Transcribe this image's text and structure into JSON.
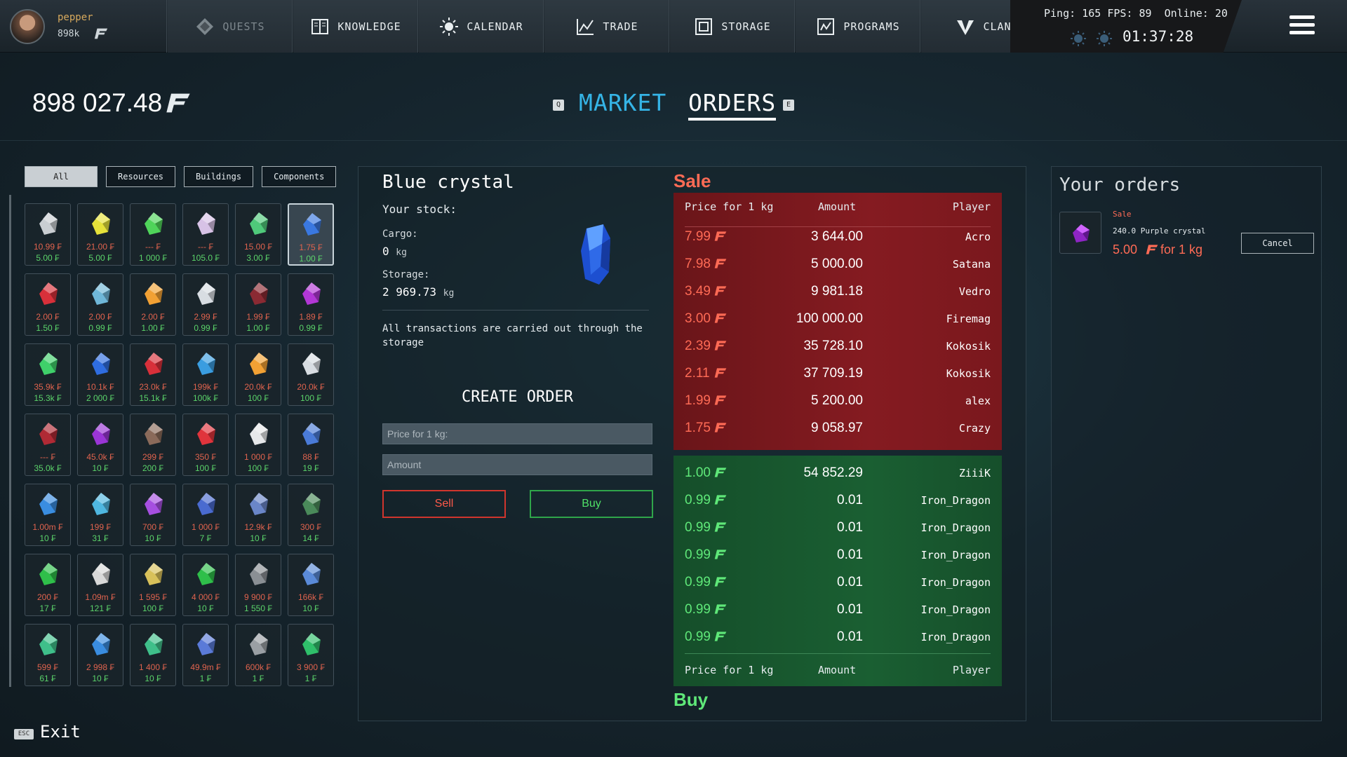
{
  "player": {
    "name": "pepper",
    "cash": "898k"
  },
  "nav": [
    {
      "label": "QUESTS",
      "icon": "diamond-icon",
      "dim": true
    },
    {
      "label": "KNOWLEDGE",
      "icon": "book-icon",
      "dim": false
    },
    {
      "label": "CALENDAR",
      "icon": "sun-icon",
      "dim": false
    },
    {
      "label": "TRADE",
      "icon": "trend-icon",
      "dim": false
    },
    {
      "label": "STORAGE",
      "icon": "box-icon",
      "dim": false
    },
    {
      "label": "PROGRAMS",
      "icon": "program-icon",
      "dim": false
    },
    {
      "label": "CLAN",
      "icon": "clan-icon",
      "dim": false
    }
  ],
  "status": {
    "ping_label": "Ping:",
    "ping": "165",
    "fps_label": "FPS:",
    "fps": "89",
    "online_label": "Online:",
    "online": "20",
    "time": "01:37:28"
  },
  "balance": "898 027.48",
  "tabs": {
    "market": "MARKET",
    "orders": "ORDERS",
    "key_left": "Q",
    "key_right": "E"
  },
  "filters": [
    "All",
    "Resources",
    "Buildings",
    "Components"
  ],
  "inventory": [
    {
      "icon": "ingot-silver-icon",
      "color": "#c9ced2",
      "p1": "10.99",
      "p2": "5.00"
    },
    {
      "icon": "ingot-gold-icon",
      "color": "#e6e23a",
      "p1": "21.00",
      "p2": "5.00"
    },
    {
      "icon": "seeds-icon",
      "color": "#4fd45a",
      "p1": "---",
      "p2": "1 000"
    },
    {
      "icon": "ingot-pink-icon",
      "color": "#d7c2e6",
      "p1": "---",
      "p2": "105.0"
    },
    {
      "icon": "green-crystal-icon",
      "color": "#4fc97a",
      "p1": "15.00",
      "p2": "3.00"
    },
    {
      "icon": "blue-crystal-icon",
      "color": "#3a78e0",
      "p1": "1.75",
      "p2": "1.00",
      "selected": true
    },
    {
      "icon": "red-crystal-icon",
      "color": "#d8303a",
      "p1": "2.00",
      "p2": "1.50"
    },
    {
      "icon": "ice-crystal-icon",
      "color": "#6fb7d8",
      "p1": "2.00",
      "p2": "0.99"
    },
    {
      "icon": "amber-crystal-icon",
      "color": "#f2a134",
      "p1": "2.00",
      "p2": "1.00"
    },
    {
      "icon": "metal-chunk-icon",
      "color": "#d8dde2",
      "p1": "2.99",
      "p2": "0.99"
    },
    {
      "icon": "dark-crystal-icon",
      "color": "#8a2a33",
      "p1": "1.99",
      "p2": "1.00"
    },
    {
      "icon": "purple-crystal-icon",
      "color": "#b237d6",
      "p1": "1.89",
      "p2": "0.99"
    },
    {
      "icon": "green-core-icon",
      "color": "#3fd06a",
      "p1": "35.9k",
      "p2": "15.3k"
    },
    {
      "icon": "blue-core-icon",
      "color": "#2f6de0",
      "p1": "10.1k",
      "p2": "2 000"
    },
    {
      "icon": "red-core-icon",
      "color": "#d8303a",
      "p1": "23.0k",
      "p2": "15.1k"
    },
    {
      "icon": "cyan-core-icon",
      "color": "#3a9de0",
      "p1": "199k",
      "p2": "100k"
    },
    {
      "icon": "gold-core-icon",
      "color": "#f2a134",
      "p1": "20.0k",
      "p2": "100"
    },
    {
      "icon": "silver-core-icon",
      "color": "#d8dde2",
      "p1": "20.0k",
      "p2": "100"
    },
    {
      "icon": "crimson-core-icon",
      "color": "#b02a35",
      "p1": "---",
      "p2": "35.0k"
    },
    {
      "icon": "violet-orb-icon",
      "color": "#9a35d6",
      "p1": "45.0k",
      "p2": "10"
    },
    {
      "icon": "dark-orb-icon",
      "color": "#8a6a5a",
      "p1": "299",
      "p2": "200"
    },
    {
      "icon": "red-pod-icon",
      "color": "#e0343c",
      "p1": "350",
      "p2": "100"
    },
    {
      "icon": "plate-icon",
      "color": "#e6e8ea",
      "p1": "1 000",
      "p2": "100"
    },
    {
      "icon": "battery-icon",
      "color": "#4a7bd8",
      "p1": "88",
      "p2": "19"
    },
    {
      "icon": "blue-gear-icon",
      "color": "#3a8de0",
      "p1": "1.00m",
      "p2": "10"
    },
    {
      "icon": "cyan-gear-icon",
      "color": "#4fb7e0",
      "p1": "199",
      "p2": "31"
    },
    {
      "icon": "purple-lamp-icon",
      "color": "#a64fe0",
      "p1": "700",
      "p2": "10"
    },
    {
      "icon": "blue-grid-icon",
      "color": "#4a6bd0",
      "p1": "1 000",
      "p2": "7"
    },
    {
      "icon": "solar-panel-icon",
      "color": "#6a86c8",
      "p1": "12.9k",
      "p2": "10"
    },
    {
      "icon": "green-cube-icon",
      "color": "#4a8a5a",
      "p1": "300",
      "p2": "14"
    },
    {
      "icon": "green-pyramid-icon",
      "color": "#2fbf4a",
      "p1": "200",
      "p2": "17"
    },
    {
      "icon": "medkit-icon",
      "color": "#d8d8d8",
      "p1": "1.09m",
      "p2": "121"
    },
    {
      "icon": "gold-box-icon",
      "color": "#d8c15a",
      "p1": "1 595",
      "p2": "100"
    },
    {
      "icon": "green-wing-icon",
      "color": "#2fbf4a",
      "p1": "4 000",
      "p2": "10"
    },
    {
      "icon": "gray-module-icon",
      "color": "#8a8f94",
      "p1": "9 900",
      "p2": "1 550"
    },
    {
      "icon": "blue-module-icon",
      "color": "#5a8ad8",
      "p1": "166k",
      "p2": "10"
    },
    {
      "icon": "green-chip-icon",
      "color": "#3fbf8a",
      "p1": "599",
      "p2": "61"
    },
    {
      "icon": "blue-chip-icon",
      "color": "#3a8de0",
      "p1": "2 998",
      "p2": "10"
    },
    {
      "icon": "teal-chip-icon",
      "color": "#3fbf8a",
      "p1": "1 400",
      "p2": "10"
    },
    {
      "icon": "blue-frame-icon",
      "color": "#5a7ad8",
      "p1": "49.9m",
      "p2": "1"
    },
    {
      "icon": "gray-capsule-icon",
      "color": "#9a9fa4",
      "p1": "600k",
      "p2": "1"
    },
    {
      "icon": "green-capsule-icon",
      "color": "#2fbf6a",
      "p1": "3 900",
      "p2": "1"
    }
  ],
  "item": {
    "name": "Blue crystal",
    "stock_label": "Your stock:",
    "cargo_label": "Cargo:",
    "cargo_value": "0",
    "storage_label": "Storage:",
    "storage_value": "2 969.73",
    "unit": "kg",
    "note": "All transactions are carried out through the storage"
  },
  "create_order": {
    "title": "CREATE ORDER",
    "price_placeholder": "Price for 1 kg:",
    "amount_placeholder": "Amount",
    "sell": "Sell",
    "buy": "Buy"
  },
  "orderbook": {
    "sale_title": "Sale",
    "buy_title": "Buy",
    "col_price": "Price for 1 kg",
    "col_amount": "Amount",
    "col_player": "Player",
    "sale_rows": [
      {
        "price": "7.99",
        "amount": "3 644.00",
        "player": "Acro"
      },
      {
        "price": "7.98",
        "amount": "5 000.00",
        "player": "Satana"
      },
      {
        "price": "3.49",
        "amount": "9 981.18",
        "player": "Vedro"
      },
      {
        "price": "3.00",
        "amount": "100 000.00",
        "player": "Firemag"
      },
      {
        "price": "2.39",
        "amount": "35 728.10",
        "player": "Kokosik"
      },
      {
        "price": "2.11",
        "amount": "37 709.19",
        "player": "Kokosik"
      },
      {
        "price": "1.99",
        "amount": "5 200.00",
        "player": "alex"
      },
      {
        "price": "1.75",
        "amount": "9 058.97",
        "player": "Crazy"
      }
    ],
    "buy_rows": [
      {
        "price": "1.00",
        "amount": "54 852.29",
        "player": "ZiiiK"
      },
      {
        "price": "0.99",
        "amount": "0.01",
        "player": "Iron_Dragon"
      },
      {
        "price": "0.99",
        "amount": "0.01",
        "player": "Iron_Dragon"
      },
      {
        "price": "0.99",
        "amount": "0.01",
        "player": "Iron_Dragon"
      },
      {
        "price": "0.99",
        "amount": "0.01",
        "player": "Iron_Dragon"
      },
      {
        "price": "0.99",
        "amount": "0.01",
        "player": "Iron_Dragon"
      },
      {
        "price": "0.99",
        "amount": "0.01",
        "player": "Iron_Dragon"
      }
    ]
  },
  "your_orders": {
    "title": "Your orders",
    "order": {
      "type": "Sale",
      "desc": "240.0 Purple crystal",
      "price": "5.00",
      "unit": "for 1 kg",
      "cancel": "Cancel"
    }
  },
  "exit": {
    "key": "ESC",
    "label": "Exit"
  },
  "colors": {
    "sale_price": "#ff6b55",
    "buy_price": "#5fe879",
    "market_tab": "#35b4e6",
    "owned_price": "#e0634e",
    "base_price": "#5bd36a"
  }
}
